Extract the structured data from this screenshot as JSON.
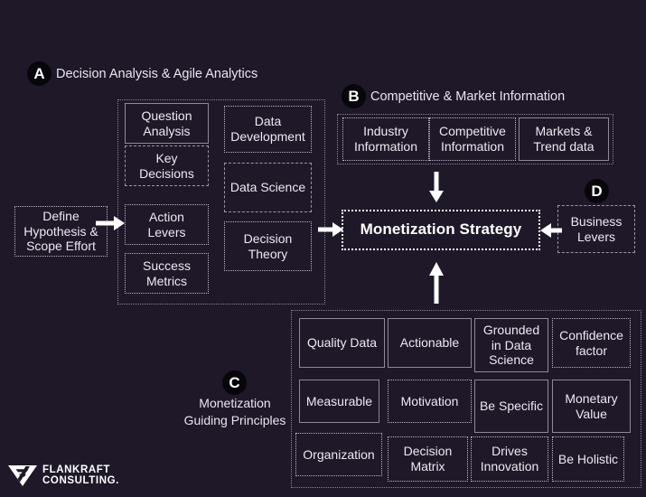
{
  "background_color": "#1e1828",
  "text_color": "#ece9f2",
  "badge_color": "#07060b",
  "sections": {
    "a": {
      "badge": "A",
      "title": "Decision Analysis & Agile Analytics",
      "left_column": [
        "Question Analysis",
        "Key Decisions",
        "Action Levers",
        "Success Metrics"
      ],
      "right_column": [
        "Data Development",
        "Data Science",
        "Decision Theory"
      ]
    },
    "b": {
      "badge": "B",
      "title": "Competitive & Market Information",
      "items": [
        "Industry Information",
        "Competitive Information",
        "Markets & Trend data"
      ]
    },
    "c": {
      "badge": "C",
      "title": "Monetization Guiding Principles",
      "items": [
        "Quality Data",
        "Actionable",
        "Grounded in Data Science",
        "Confidence factor",
        "Measurable",
        "Motivation",
        "Be Specific",
        "Monetary Value",
        "Organization",
        "Decision Matrix",
        "Drives Innovation",
        "Be Holistic"
      ]
    },
    "d": {
      "badge": "D",
      "title": "",
      "items": [
        "Business Levers"
      ]
    }
  },
  "input_node": "Define Hypothesis & Scope Effort",
  "center_node": "Monetization Strategy",
  "logo": {
    "line1": "FLANKRAFT",
    "line2": "CONSULTING."
  }
}
